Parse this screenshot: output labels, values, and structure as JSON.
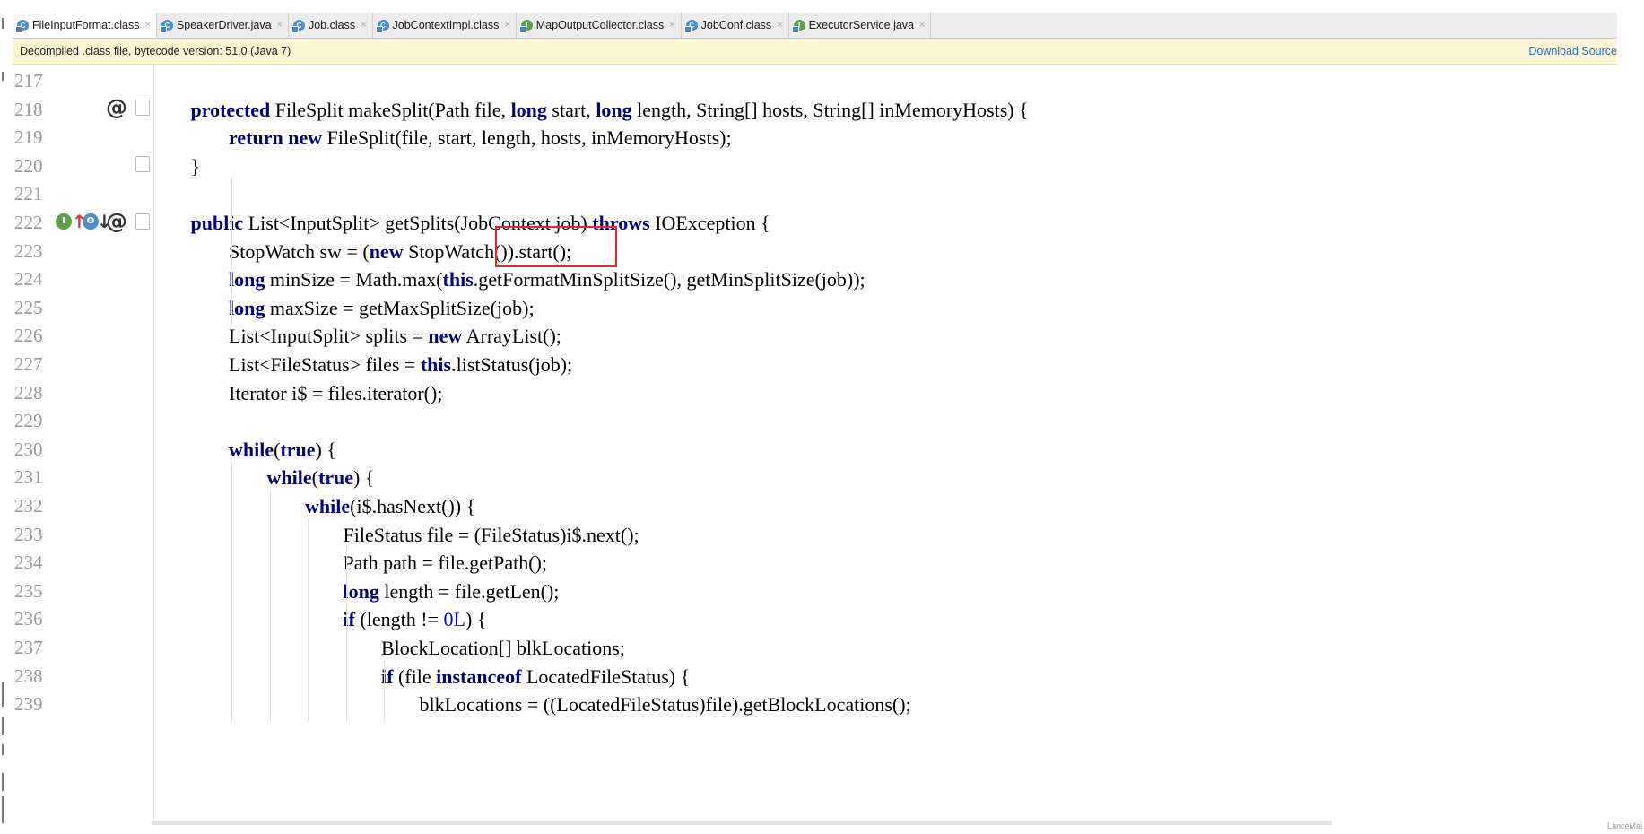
{
  "tabs": [
    {
      "label": "FileInputFormat.class",
      "icon": "class-icon",
      "active": true
    },
    {
      "label": "SpeakerDriver.java",
      "icon": "class-icon"
    },
    {
      "label": "Job.class",
      "icon": "class-icon"
    },
    {
      "label": "JobContextImpl.class",
      "icon": "class-icon"
    },
    {
      "label": "MapOutputCollector.class",
      "icon": "interface-icon"
    },
    {
      "label": "JobConf.class",
      "icon": "class-icon"
    },
    {
      "label": "ExecutorService.java",
      "icon": "interface-icon"
    }
  ],
  "notice": {
    "message": "Decompiled .class file, bytecode version: 51.0 (Java 7)",
    "download_label": "Download Source"
  },
  "gutter_icons": {
    "at": "@",
    "implements_badge": "I",
    "overrides_badge": "O"
  },
  "lines": [
    {
      "n": "217",
      "indent": 0,
      "tokens": []
    },
    {
      "n": "218",
      "indent": 1,
      "tokens": [
        [
          "kw",
          "protected"
        ],
        [
          "t",
          " FileSplit makeSplit(Path file, "
        ],
        [
          "kw",
          "long"
        ],
        [
          "t",
          " start, "
        ],
        [
          "kw",
          "long"
        ],
        [
          "t",
          " length, String[] hosts, String[] inMemoryHosts) {"
        ]
      ]
    },
    {
      "n": "219",
      "indent": 2,
      "tokens": [
        [
          "kw",
          "return"
        ],
        [
          "t",
          " "
        ],
        [
          "kw",
          "new"
        ],
        [
          "t",
          " FileSplit(file, start, length, hosts, inMemoryHosts);"
        ]
      ]
    },
    {
      "n": "220",
      "indent": 1,
      "tokens": [
        [
          "t",
          "}"
        ]
      ]
    },
    {
      "n": "221",
      "indent": 0,
      "tokens": []
    },
    {
      "n": "222",
      "indent": 1,
      "tokens": [
        [
          "kw",
          "public"
        ],
        [
          "t",
          " List<InputSplit> getSplits(JobContext job) "
        ],
        [
          "kw",
          "throws"
        ],
        [
          "t",
          " IOException {"
        ]
      ]
    },
    {
      "n": "223",
      "indent": 2,
      "tokens": [
        [
          "t",
          "StopWatch sw = ("
        ],
        [
          "kw",
          "new"
        ],
        [
          "t",
          " StopWatch()).start();"
        ]
      ]
    },
    {
      "n": "224",
      "indent": 2,
      "tokens": [
        [
          "kw",
          "long"
        ],
        [
          "t",
          " minSize = Math.max("
        ],
        [
          "kw",
          "this"
        ],
        [
          "t",
          ".getFormatMinSplitSize(), getMinSplitSize(job));"
        ]
      ]
    },
    {
      "n": "225",
      "indent": 2,
      "tokens": [
        [
          "kw",
          "long"
        ],
        [
          "t",
          " maxSize = getMaxSplitSize(job);"
        ]
      ]
    },
    {
      "n": "226",
      "indent": 2,
      "tokens": [
        [
          "t",
          "List<InputSplit> splits = "
        ],
        [
          "kw",
          "new"
        ],
        [
          "t",
          " ArrayList();"
        ]
      ]
    },
    {
      "n": "227",
      "indent": 2,
      "tokens": [
        [
          "t",
          "List<FileStatus> files = "
        ],
        [
          "kw",
          "this"
        ],
        [
          "t",
          ".listStatus(job);"
        ]
      ]
    },
    {
      "n": "228",
      "indent": 2,
      "tokens": [
        [
          "t",
          "Iterator i$ = files.iterator();"
        ]
      ]
    },
    {
      "n": "229",
      "indent": 0,
      "tokens": []
    },
    {
      "n": "230",
      "indent": 2,
      "tokens": [
        [
          "kw",
          "while"
        ],
        [
          "t",
          "("
        ],
        [
          "kw",
          "true"
        ],
        [
          "t",
          ") {"
        ]
      ]
    },
    {
      "n": "231",
      "indent": 3,
      "tokens": [
        [
          "kw",
          "while"
        ],
        [
          "t",
          "("
        ],
        [
          "kw",
          "true"
        ],
        [
          "t",
          ") {"
        ]
      ]
    },
    {
      "n": "232",
      "indent": 4,
      "tokens": [
        [
          "kw",
          "while"
        ],
        [
          "t",
          "(i$.hasNext()) {"
        ]
      ]
    },
    {
      "n": "233",
      "indent": 5,
      "tokens": [
        [
          "t",
          "FileStatus file = (FileStatus)i$.next();"
        ]
      ]
    },
    {
      "n": "234",
      "indent": 5,
      "tokens": [
        [
          "t",
          "Path path = file.getPath();"
        ]
      ]
    },
    {
      "n": "235",
      "indent": 5,
      "tokens": [
        [
          "kw",
          "long"
        ],
        [
          "t",
          " length = file.getLen();"
        ]
      ]
    },
    {
      "n": "236",
      "indent": 5,
      "tokens": [
        [
          "kw",
          "if"
        ],
        [
          "t",
          " (length != "
        ],
        [
          "num",
          "0L"
        ],
        [
          "t",
          ") {"
        ]
      ]
    },
    {
      "n": "237",
      "indent": 6,
      "tokens": [
        [
          "t",
          "BlockLocation[] blkLocations;"
        ]
      ]
    },
    {
      "n": "238",
      "indent": 6,
      "tokens": [
        [
          "kw",
          "if"
        ],
        [
          "t",
          " (file "
        ],
        [
          "kw",
          "instanceof"
        ],
        [
          "t",
          " LocatedFileStatus) {"
        ]
      ]
    },
    {
      "n": "239",
      "indent": 7,
      "tokens": [
        [
          "t",
          "blkLocations = ((LocatedFileStatus)file).getBlockLocations();"
        ]
      ]
    }
  ],
  "watermark": "LanceMai"
}
